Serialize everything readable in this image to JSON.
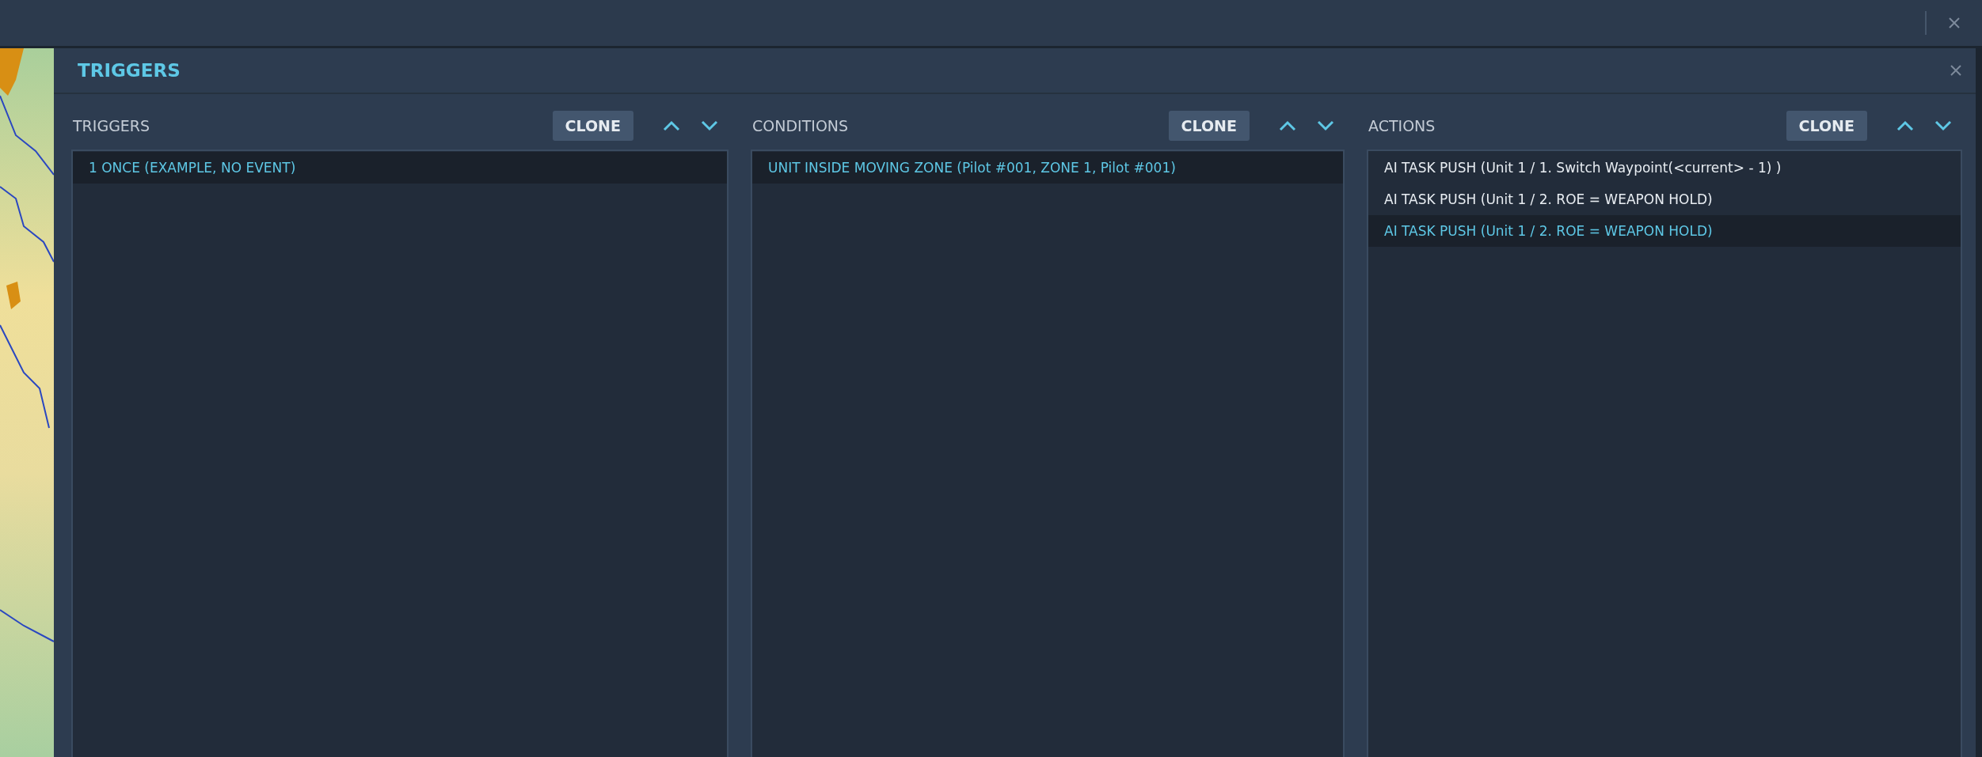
{
  "dialog": {
    "title": "TRIGGERS"
  },
  "panels": [
    {
      "title": "TRIGGERS",
      "clone_button": "CLONE",
      "items": [
        {
          "label": "1 ONCE (EXAMPLE, NO EVENT)",
          "selected": true
        }
      ]
    },
    {
      "title": "CONDITIONS",
      "clone_button": "CLONE",
      "items": [
        {
          "label": "UNIT INSIDE MOVING ZONE (Pilot #001, ZONE 1, Pilot #001)",
          "selected": true
        }
      ]
    },
    {
      "title": "ACTIONS",
      "clone_button": "CLONE",
      "items": [
        {
          "label": "AI TASK PUSH (Unit 1 / 1. Switch Waypoint(<current> - 1) )",
          "selected": false
        },
        {
          "label": "AI TASK PUSH (Unit 1 / 2. ROE = WEAPON HOLD)",
          "selected": false
        },
        {
          "label": "AI TASK PUSH (Unit 1 / 2. ROE = WEAPON HOLD)",
          "selected": true
        }
      ]
    }
  ]
}
